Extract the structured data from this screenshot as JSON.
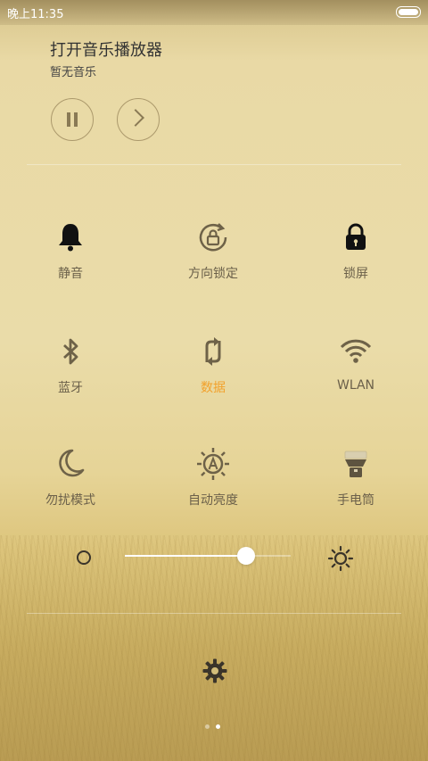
{
  "status": {
    "time": "晚上11:35"
  },
  "player": {
    "title": "打开音乐播放器",
    "subtitle": "暂无音乐"
  },
  "toggles": [
    {
      "label": "静音",
      "icon": "bell-icon",
      "active": false
    },
    {
      "label": "方向锁定",
      "icon": "rotation-lock-icon",
      "active": false
    },
    {
      "label": "锁屏",
      "icon": "lock-icon",
      "active": false
    },
    {
      "label": "蓝牙",
      "icon": "bluetooth-icon",
      "active": false
    },
    {
      "label": "数据",
      "icon": "mobile-data-icon",
      "active": true
    },
    {
      "label": "WLAN",
      "icon": "wifi-icon",
      "active": false
    },
    {
      "label": "勿扰模式",
      "icon": "moon-icon",
      "active": false
    },
    {
      "label": "自动亮度",
      "icon": "auto-brightness-icon",
      "active": false
    },
    {
      "label": "手电筒",
      "icon": "flashlight-icon",
      "active": false
    }
  ],
  "brightness": {
    "level": 0.74
  },
  "colors": {
    "active": "#f2a12b",
    "label": "#6b604a"
  },
  "pager": {
    "pages": 2,
    "current": 2
  }
}
